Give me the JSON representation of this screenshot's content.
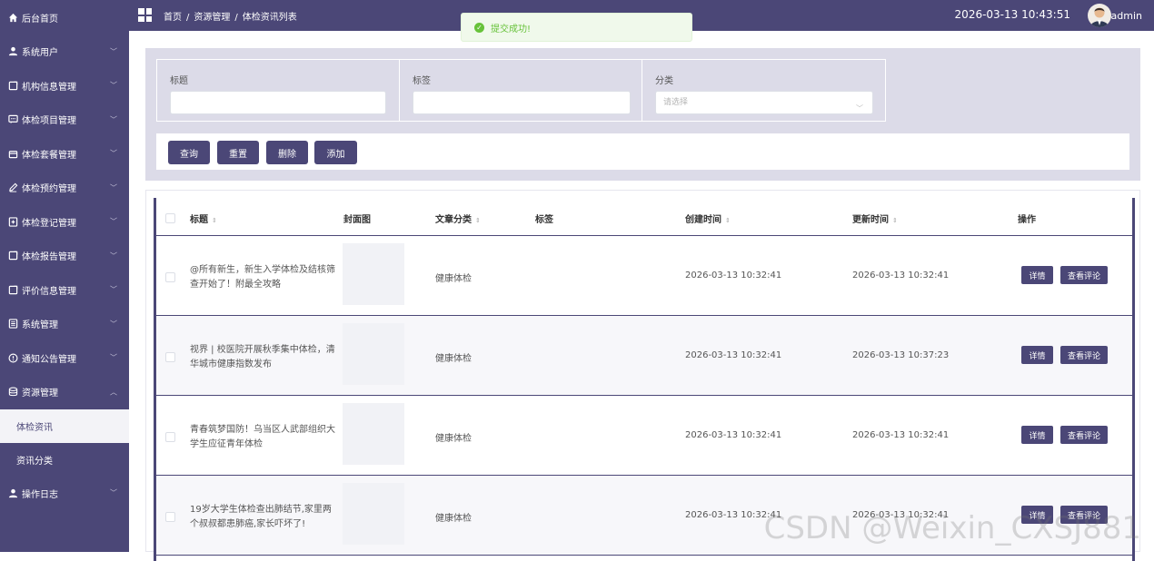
{
  "sidebar": {
    "items": [
      {
        "label": "后台首页",
        "icon": "home-icon"
      },
      {
        "label": "系统用户",
        "icon": "user-icon"
      },
      {
        "label": "机构信息管理",
        "icon": "doc-icon"
      },
      {
        "label": "体检项目管理",
        "icon": "chat-icon"
      },
      {
        "label": "体检套餐管理",
        "icon": "box-icon"
      },
      {
        "label": "体检预约管理",
        "icon": "edit-icon"
      },
      {
        "label": "体检登记管理",
        "icon": "add-doc-icon"
      },
      {
        "label": "体检报告管理",
        "icon": "doc-icon"
      },
      {
        "label": "评价信息管理",
        "icon": "doc-icon"
      },
      {
        "label": "系统管理",
        "icon": "list-icon"
      },
      {
        "label": "通知公告管理",
        "icon": "info-icon"
      },
      {
        "label": "资源管理",
        "icon": "database-icon"
      }
    ],
    "sub_items": [
      {
        "label": "体检资讯"
      },
      {
        "label": "资讯分类"
      }
    ],
    "last_item": {
      "label": "操作日志",
      "icon": "user-icon"
    }
  },
  "topbar": {
    "breadcrumb": [
      "首页",
      "资源管理",
      "体检资讯列表"
    ],
    "datetime": "2026-03-13 10:43:51",
    "username": "admin"
  },
  "toast": {
    "message": "提交成功!"
  },
  "search": {
    "fields": [
      {
        "label": "标题",
        "placeholder": ""
      },
      {
        "label": "标签",
        "placeholder": ""
      },
      {
        "label": "分类",
        "placeholder": "请选择"
      }
    ],
    "buttons": [
      "查询",
      "重置",
      "删除",
      "添加"
    ]
  },
  "table": {
    "headers": [
      "标题",
      "封面图",
      "文章分类",
      "标签",
      "创建时间",
      "更新时间",
      "操作"
    ],
    "rows": [
      {
        "title": "@所有新生，新生入学体检及结核筛查开始了！附最全攻略",
        "category": "健康体检",
        "tags": "",
        "created": "2026-03-13 10:32:41",
        "updated": "2026-03-13 10:32:41"
      },
      {
        "title": "视界 | 校医院开展秋季集中体检，清华城市健康指数发布",
        "category": "健康体检",
        "tags": "",
        "created": "2026-03-13 10:32:41",
        "updated": "2026-03-13 10:37:23"
      },
      {
        "title": "青春筑梦国防！乌当区人武部组织大学生应征青年体检",
        "category": "健康体检",
        "tags": "",
        "created": "2026-03-13 10:32:41",
        "updated": "2026-03-13 10:32:41"
      },
      {
        "title": "19岁大学生体检查出肺结节,家里两个叔叔都患肺癌,家长吓坏了!",
        "category": "健康体检",
        "tags": "",
        "created": "2026-03-13 10:32:41",
        "updated": "2026-03-13 10:32:41"
      }
    ],
    "action_labels": {
      "detail": "详情",
      "comments": "查看评论"
    }
  },
  "watermark": "CSDN @Weixin_CXSJ881",
  "colors": {
    "primary": "#4b4777",
    "success": "#67c23a",
    "panel": "#dcdbe8"
  }
}
